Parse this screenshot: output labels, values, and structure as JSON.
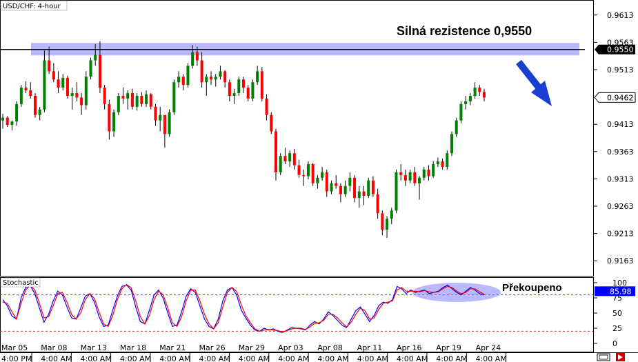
{
  "chart_data": [
    {
      "type": "candlestick",
      "title": "USD/CHF: 4-hour",
      "ylim": [
        0.9138,
        0.9638
      ],
      "yticks": [
        "0.9613",
        "0.9563",
        "0.9513",
        "0.9413",
        "0.9363",
        "0.9313",
        "0.9263",
        "0.9213",
        "0.9163"
      ],
      "ytick_values": [
        0.9613,
        0.9563,
        0.9513,
        0.9413,
        0.9363,
        0.9313,
        0.9263,
        0.9213,
        0.9163
      ],
      "price_badges": [
        {
          "label": "0.9550",
          "value": 0.955,
          "style": "dark"
        },
        {
          "label": "0.9462",
          "value": 0.9462,
          "style": "light"
        }
      ],
      "resistance": {
        "value": 0.955,
        "zone": [
          0.9539,
          0.9562
        ],
        "label": "Silná rezistence 0,9550"
      },
      "arrow_direction": "down-right",
      "grid": false,
      "candles": [
        [
          0.942,
          0.9432,
          0.9405,
          0.9425
        ],
        [
          0.9425,
          0.9428,
          0.9408,
          0.9412
        ],
        [
          0.9412,
          0.942,
          0.9402,
          0.9418
        ],
        [
          0.9418,
          0.9455,
          0.941,
          0.945
        ],
        [
          0.945,
          0.9485,
          0.9445,
          0.948
        ],
        [
          0.948,
          0.9492,
          0.947,
          0.9475
        ],
        [
          0.9475,
          0.949,
          0.946,
          0.9465
        ],
        [
          0.9465,
          0.947,
          0.9425,
          0.943
        ],
        [
          0.943,
          0.9445,
          0.942,
          0.944
        ],
        [
          0.944,
          0.9548,
          0.9435,
          0.953
        ],
        [
          0.953,
          0.9555,
          0.9505,
          0.951
        ],
        [
          0.951,
          0.9525,
          0.949,
          0.9495
        ],
        [
          0.9495,
          0.951,
          0.947,
          0.948
        ],
        [
          0.948,
          0.9505,
          0.9475,
          0.9498
        ],
        [
          0.9498,
          0.9502,
          0.946,
          0.9465
        ],
        [
          0.9465,
          0.948,
          0.944,
          0.947
        ],
        [
          0.947,
          0.949,
          0.9455,
          0.9462
        ],
        [
          0.9462,
          0.947,
          0.943,
          0.9448
        ],
        [
          0.9448,
          0.951,
          0.944,
          0.95
        ],
        [
          0.95,
          0.9535,
          0.9495,
          0.953
        ],
        [
          0.953,
          0.956,
          0.952,
          0.954
        ],
        [
          0.954,
          0.9565,
          0.947,
          0.948
        ],
        [
          0.948,
          0.9485,
          0.944,
          0.945
        ],
        [
          0.945,
          0.9458,
          0.9385,
          0.94
        ],
        [
          0.94,
          0.944,
          0.939,
          0.9435
        ],
        [
          0.9435,
          0.947,
          0.943,
          0.9465
        ],
        [
          0.9465,
          0.948,
          0.945,
          0.946
        ],
        [
          0.946,
          0.9475,
          0.944,
          0.947
        ],
        [
          0.947,
          0.9478,
          0.944,
          0.9445
        ],
        [
          0.9445,
          0.947,
          0.9438,
          0.9465
        ],
        [
          0.9465,
          0.9472,
          0.9445,
          0.945
        ],
        [
          0.945,
          0.9475,
          0.9445,
          0.9468
        ],
        [
          0.9468,
          0.947,
          0.944,
          0.9445
        ],
        [
          0.9445,
          0.945,
          0.941,
          0.942
        ],
        [
          0.942,
          0.9445,
          0.94,
          0.943
        ],
        [
          0.943,
          0.942,
          0.937,
          0.9395
        ],
        [
          0.9395,
          0.944,
          0.939,
          0.9435
        ],
        [
          0.9435,
          0.9495,
          0.943,
          0.949
        ],
        [
          0.949,
          0.951,
          0.948,
          0.95
        ],
        [
          0.95,
          0.9505,
          0.9475,
          0.9485
        ],
        [
          0.9485,
          0.9525,
          0.948,
          0.952
        ],
        [
          0.952,
          0.9558,
          0.9515,
          0.9545
        ],
        [
          0.9545,
          0.9555,
          0.952,
          0.953
        ],
        [
          0.953,
          0.9545,
          0.948,
          0.949
        ],
        [
          0.949,
          0.9505,
          0.9465,
          0.95
        ],
        [
          0.95,
          0.951,
          0.9485,
          0.9495
        ],
        [
          0.9495,
          0.9505,
          0.9482,
          0.95
        ],
        [
          0.95,
          0.952,
          0.9495,
          0.951
        ],
        [
          0.951,
          0.9512,
          0.948,
          0.949
        ],
        [
          0.949,
          0.9495,
          0.9455,
          0.9465
        ],
        [
          0.9465,
          0.9478,
          0.945,
          0.947
        ],
        [
          0.947,
          0.95,
          0.9465,
          0.9495
        ],
        [
          0.9495,
          0.95,
          0.947,
          0.948
        ],
        [
          0.948,
          0.9485,
          0.9455,
          0.946
        ],
        [
          0.946,
          0.9495,
          0.9455,
          0.949
        ],
        [
          0.949,
          0.952,
          0.9485,
          0.951
        ],
        [
          0.951,
          0.9518,
          0.9455,
          0.946
        ],
        [
          0.946,
          0.9468,
          0.942,
          0.943
        ],
        [
          0.943,
          0.9435,
          0.9395,
          0.94
        ],
        [
          0.94,
          0.9405,
          0.931,
          0.9325
        ],
        [
          0.9325,
          0.936,
          0.932,
          0.9355
        ],
        [
          0.9355,
          0.937,
          0.934,
          0.9345
        ],
        [
          0.9345,
          0.9365,
          0.9335,
          0.936
        ],
        [
          0.936,
          0.9368,
          0.933,
          0.9338
        ],
        [
          0.9338,
          0.9348,
          0.9315,
          0.932
        ],
        [
          0.932,
          0.933,
          0.93,
          0.9318
        ],
        [
          0.9318,
          0.9345,
          0.9312,
          0.934
        ],
        [
          0.934,
          0.9342,
          0.93,
          0.9305
        ],
        [
          0.9305,
          0.932,
          0.9295,
          0.9315
        ],
        [
          0.9315,
          0.9335,
          0.931,
          0.9325
        ],
        [
          0.9325,
          0.933,
          0.928,
          0.929
        ],
        [
          0.929,
          0.931,
          0.9285,
          0.9305
        ],
        [
          0.9305,
          0.932,
          0.9295,
          0.93
        ],
        [
          0.93,
          0.9305,
          0.927,
          0.9285
        ],
        [
          0.9285,
          0.931,
          0.928,
          0.93
        ],
        [
          0.93,
          0.9325,
          0.929,
          0.9315
        ],
        [
          0.9315,
          0.932,
          0.927,
          0.9278
        ],
        [
          0.9278,
          0.93,
          0.926,
          0.929
        ],
        [
          0.929,
          0.93,
          0.9265,
          0.9282
        ],
        [
          0.9282,
          0.9315,
          0.9278,
          0.931
        ],
        [
          0.931,
          0.9318,
          0.928,
          0.9285
        ],
        [
          0.9285,
          0.9295,
          0.924,
          0.925
        ],
        [
          0.925,
          0.9255,
          0.921,
          0.922
        ],
        [
          0.922,
          0.9245,
          0.9205,
          0.924
        ],
        [
          0.924,
          0.926,
          0.923,
          0.9255
        ],
        [
          0.9255,
          0.933,
          0.925,
          0.9325
        ],
        [
          0.9325,
          0.934,
          0.931,
          0.932
        ],
        [
          0.932,
          0.933,
          0.93,
          0.931
        ],
        [
          0.931,
          0.933,
          0.9305,
          0.9325
        ],
        [
          0.9325,
          0.9335,
          0.93,
          0.9305
        ],
        [
          0.9305,
          0.9318,
          0.9275,
          0.9315
        ],
        [
          0.9315,
          0.9335,
          0.931,
          0.933
        ],
        [
          0.933,
          0.9338,
          0.931,
          0.9318
        ],
        [
          0.9318,
          0.9345,
          0.9315,
          0.934
        ],
        [
          0.934,
          0.9352,
          0.9335,
          0.9345
        ],
        [
          0.9345,
          0.935,
          0.933,
          0.9335
        ],
        [
          0.9335,
          0.9365,
          0.933,
          0.936
        ],
        [
          0.936,
          0.94,
          0.9355,
          0.9395
        ],
        [
          0.9395,
          0.9425,
          0.939,
          0.942
        ],
        [
          0.942,
          0.9455,
          0.9415,
          0.945
        ],
        [
          0.945,
          0.9465,
          0.944,
          0.9455
        ],
        [
          0.9455,
          0.947,
          0.9448,
          0.9465
        ],
        [
          0.9465,
          0.949,
          0.946,
          0.948
        ],
        [
          0.948,
          0.9485,
          0.9465,
          0.9472
        ],
        [
          0.9472,
          0.9478,
          0.9455,
          0.9462
        ]
      ]
    },
    {
      "type": "line",
      "title": "Stochastic",
      "ylim": [
        0,
        100
      ],
      "yticks": [
        "100",
        "75",
        "50",
        "25",
        "0"
      ],
      "ytick_values": [
        100,
        75,
        50,
        25,
        0
      ],
      "levels": [
        80,
        20
      ],
      "badge": {
        "label": "85.98",
        "value": 85.98
      },
      "annotation": "Překoupeno",
      "series": [
        {
          "color": "#0000ff",
          "values": [
            72,
            62,
            45,
            40,
            75,
            92,
            95,
            82,
            58,
            35,
            48,
            70,
            86,
            80,
            60,
            42,
            40,
            58,
            78,
            82,
            68,
            44,
            28,
            30,
            55,
            78,
            94,
            96,
            88,
            60,
            36,
            32,
            55,
            80,
            88,
            74,
            50,
            28,
            30,
            52,
            78,
            90,
            84,
            62,
            40,
            28,
            24,
            40,
            70,
            88,
            92,
            80,
            55,
            42,
            30,
            22,
            20,
            25,
            22,
            24,
            20,
            18,
            22,
            26,
            25,
            24,
            22,
            30,
            36,
            32,
            40,
            52,
            46,
            38,
            30,
            26,
            40,
            54,
            60,
            48,
            36,
            46,
            62,
            68,
            66,
            72,
            94,
            90,
            82,
            88,
            84,
            86,
            88,
            82,
            84,
            86,
            92,
            96,
            90,
            84,
            80,
            86,
            92,
            88,
            82,
            80
          ]
        },
        {
          "color": "#ff0000",
          "values": [
            68,
            66,
            52,
            40,
            66,
            88,
            96,
            88,
            66,
            42,
            44,
            62,
            82,
            84,
            68,
            48,
            40,
            50,
            72,
            82,
            74,
            52,
            32,
            28,
            46,
            72,
            90,
            97,
            92,
            70,
            44,
            32,
            46,
            72,
            86,
            80,
            58,
            34,
            28,
            44,
            70,
            88,
            88,
            70,
            48,
            32,
            24,
            34,
            60,
            84,
            92,
            86,
            64,
            46,
            34,
            24,
            20,
            22,
            23,
            22,
            21,
            19,
            21,
            24,
            25,
            25,
            23,
            27,
            33,
            34,
            38,
            48,
            48,
            42,
            34,
            27,
            35,
            48,
            58,
            54,
            40,
            42,
            56,
            66,
            68,
            70,
            88,
            92,
            86,
            86,
            86,
            85,
            87,
            85,
            84,
            85,
            90,
            94,
            92,
            86,
            82,
            84,
            90,
            90,
            85,
            81
          ]
        }
      ]
    }
  ],
  "x_axis": {
    "dates": [
      "Mar 05",
      "Mar 08",
      "Mar 13",
      "Mar 18",
      "Mar 21",
      "Mar 26",
      "Mar 29",
      "Apr 03",
      "Apr 08",
      "Apr 11",
      "Apr 16",
      "Apr 19",
      "Apr 24"
    ],
    "times": [
      "4:00 PM",
      "4:00 AM",
      "4:00 AM",
      "4:00 AM",
      "4:00 AM",
      "4:00 AM",
      "4:00 AM",
      "4:00 AM",
      "4:00 AM",
      "4:00 AM",
      "4:00 AM",
      "4:00 AM",
      "4:00 AM"
    ]
  },
  "colors": {
    "up": "#008000",
    "down": "#ff0000",
    "wick": "#000000",
    "zone": "#8080ff",
    "badge_dark": "#000000",
    "badge_stoch": "#0000ff"
  }
}
